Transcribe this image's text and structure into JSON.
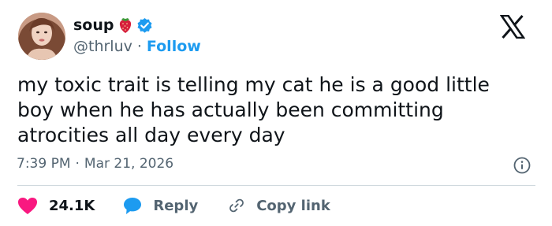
{
  "author": {
    "name": "soup",
    "name_emoji_icon": "strawberry-icon",
    "verified_icon": "verified-badge-icon",
    "handle": "@thrluv",
    "separator": "·",
    "follow_label": "Follow"
  },
  "tweet": {
    "text": "my toxic trait is telling my cat he is a good little boy when he has actually been committing atrocities all day every day",
    "time": "7:39 PM",
    "separator": "·",
    "date": "Mar 21, 2026"
  },
  "actions": {
    "like_count": "24.1K",
    "reply_label": "Reply",
    "copy_label": "Copy link"
  },
  "icons": {
    "logo": "x-logo-icon",
    "info": "info-icon",
    "like": "heart-icon",
    "reply": "speech-bubble-icon",
    "copy": "link-icon"
  },
  "colors": {
    "accent": "#1d9bf0",
    "like": "#f91880",
    "text": "#0f1419",
    "secondary": "#536471",
    "divider": "#cfd9de"
  }
}
